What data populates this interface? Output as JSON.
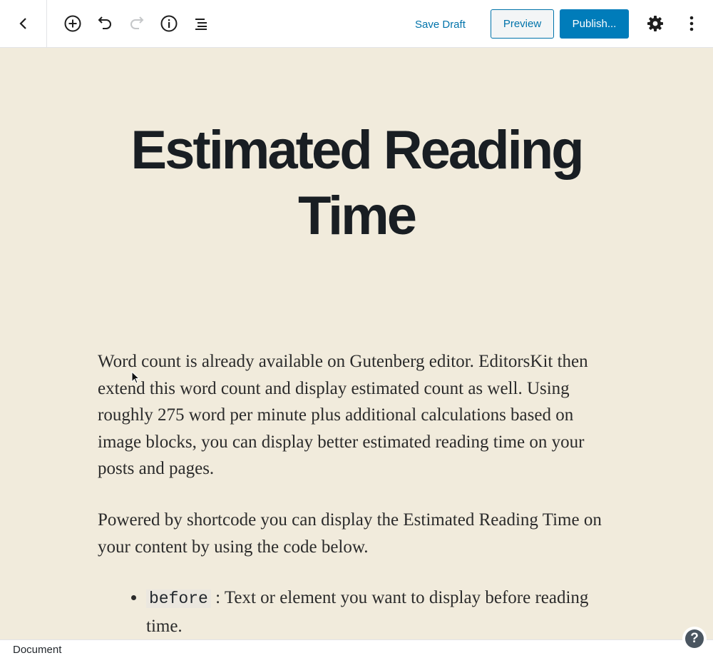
{
  "toolbar": {
    "save_draft_label": "Save Draft",
    "preview_label": "Preview",
    "publish_label": "Publish..."
  },
  "icons": {
    "back": "chevron-left-icon",
    "add_block": "plus-circle-icon",
    "undo": "undo-icon",
    "redo": "redo-icon",
    "info": "info-icon",
    "outline": "list-icon",
    "settings": "gear-icon",
    "more": "kebab-menu-icon",
    "help": "help-icon"
  },
  "post": {
    "title": "Estimated Reading Time",
    "paragraph_1": "Word count is already available on Gutenberg editor. EditorsKit then extend this word count and display estimated count as well. Using roughly 275 word per minute plus additional calculations based on image blocks, you can display better estimated reading time on your posts and pages.",
    "paragraph_2": "Powered by shortcode you can display the Estimated Reading Time on your content by using the code below.",
    "list": [
      {
        "code": "before",
        "text": " : Text or element you want to display before reading time."
      }
    ]
  },
  "statusbar": {
    "breadcrumb": "Document",
    "help_label": "?"
  },
  "colors": {
    "accent": "#0073aa",
    "primary_button": "#007cba",
    "canvas_background": "#f1ebdc",
    "title_text": "#191e23"
  }
}
